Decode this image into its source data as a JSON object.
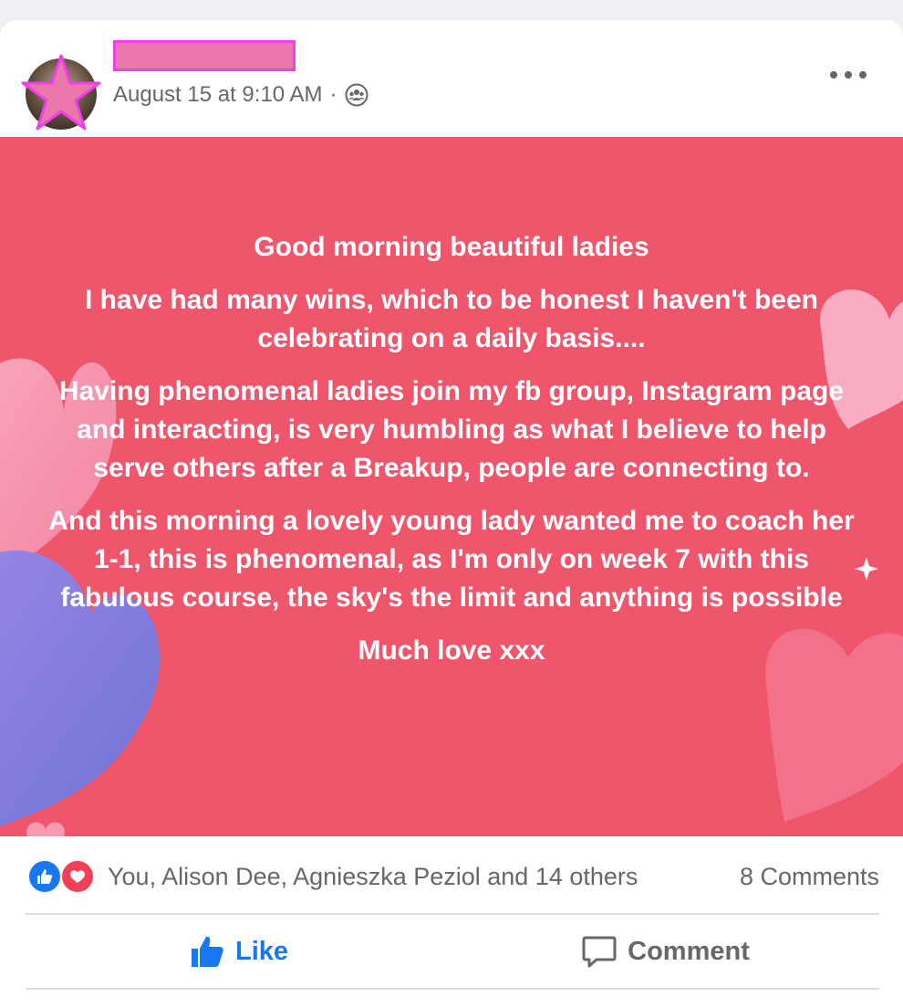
{
  "post": {
    "timestamp": "August 15 at 9:10 AM",
    "separator": "·",
    "audience_icon": "group-icon",
    "background_color": "#ef566c",
    "text_color": "#ffffff",
    "paragraphs": [
      "Good morning beautiful ladies",
      "I have had many wins, which to be honest I haven't been celebrating on a daily basis....",
      "Having phenomenal ladies join my fb group, Instagram page and interacting, is very humbling as what I believe to help serve others after a Breakup, people are connecting to.",
      "And this morning a lovely young lady wanted me to coach her 1-1, this is phenomenal, as I'm only on week 7 with this fabulous course, the sky's the limit and anything is possible",
      "Much love xxx"
    ]
  },
  "author": {
    "avatar_overlay": "star-icon",
    "name_redaction_color": "#ea77a9"
  },
  "reactions": {
    "icons": [
      "like-icon",
      "love-icon"
    ],
    "reactors": "You, Alison Dee, Agnieszka Peziol and 14 others",
    "comments": "8 Comments"
  },
  "actions": {
    "like_label": "Like",
    "comment_label": "Comment",
    "like_color": "#1877f2"
  }
}
